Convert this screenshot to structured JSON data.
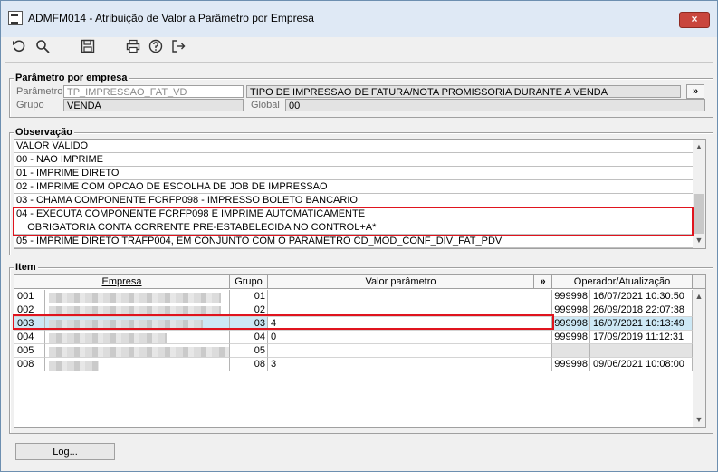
{
  "window": {
    "title": "ADMFM014 - Atribuição de Valor a Parâmetro por Empresa",
    "close_label": "×"
  },
  "toolbar": {
    "icons": [
      "undo-icon",
      "search-icon",
      "save-icon",
      "print-icon",
      "help-icon",
      "exit-icon"
    ]
  },
  "param_group": {
    "title": "Parâmetro por empresa",
    "parametro_label": "Parâmetro",
    "parametro_value": "TP_IMPRESSAO_FAT_VD",
    "descricao_value": "TIPO DE IMPRESSAO DE FATURA/NOTA PROMISSORIA DURANTE A VENDA",
    "more_label": "»",
    "grupo_label": "Grupo",
    "grupo_value": "VENDA",
    "global_label": "Global",
    "global_value": "00"
  },
  "observacao": {
    "title": "Observação",
    "lines": [
      "VALOR VALIDO",
      "00 - NAO IMPRIME",
      "01 - IMPRIME DIRETO",
      "02 - IMPRIME COM OPCAO DE ESCOLHA DE JOB DE IMPRESSAO",
      "03 - CHAMA COMPONENTE FCRFP098 - IMPRESSO BOLETO BANCARIO",
      "04 - EXECUTA COMPONENTE FCRFP098 E IMPRIME AUTOMATICAMENTE",
      "    OBRIGATORIA CONTA CORRENTE PRE-ESTABELECIDA NO CONTROL+A*",
      "05 - IMPRIME DIRETO TRAFP004, EM CONJUNTO COM O PARAMETRO CD_MOD_CONF_DIV_FAT_PDV"
    ]
  },
  "item": {
    "title": "Item",
    "columns": {
      "empresa": "Empresa",
      "grupo": "Grupo",
      "valor": "Valor parâmetro",
      "more": "»",
      "operador": "Operador/Atualização"
    },
    "rows": [
      {
        "codigo": "001",
        "grupo": "01",
        "valor": "",
        "operador": "999998",
        "data": "16/07/2021 10:30:50"
      },
      {
        "codigo": "002",
        "grupo": "02",
        "valor": "",
        "operador": "999998",
        "data": "26/09/2018 22:07:38"
      },
      {
        "codigo": "003",
        "grupo": "03",
        "valor": "4",
        "operador": "999998",
        "data": "16/07/2021 10:13:49"
      },
      {
        "codigo": "004",
        "grupo": "04",
        "valor": "0",
        "operador": "999998",
        "data": "17/09/2019 11:12:31"
      },
      {
        "codigo": "005",
        "grupo": "05",
        "valor": "",
        "operador": "",
        "data": ""
      },
      {
        "codigo": "008",
        "grupo": "08",
        "valor": "3",
        "operador": "999998",
        "data": "09/06/2021 10:08:00"
      }
    ]
  },
  "footer": {
    "log_label": "Log..."
  },
  "colors": {
    "highlight": "#e0141e",
    "selected_row": "#cde8f5",
    "close": "#c9463d"
  }
}
